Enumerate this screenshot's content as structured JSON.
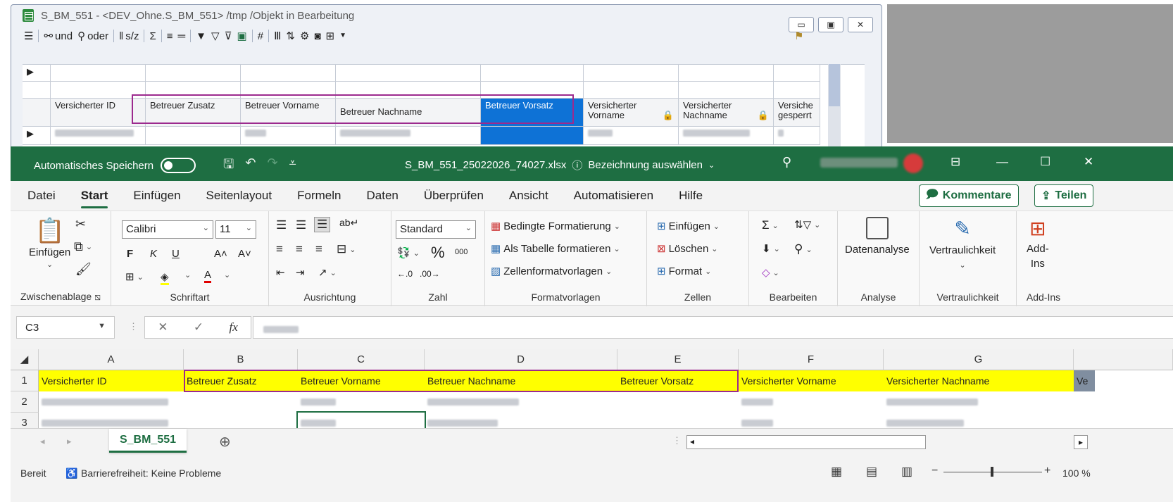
{
  "bg_window": {
    "title": "S_BM_551 - <DEV_Ohne.S_BM_551> /tmp /Objekt in Bearbeitung",
    "controls": {
      "minimize": "▭",
      "maximize": "▣",
      "close": "✕"
    },
    "toolbar": {
      "und_label": "und",
      "oder_label": "oder",
      "sz_label": "s/z",
      "hash_label": "#"
    },
    "grid": {
      "headers": [
        "Versicherter ID",
        "Betreuer Zusatz",
        "Betreuer Vorname",
        "Betreuer Nachname",
        "Betreuer Vorsatz",
        "Versicherter Vorname",
        "Versicherter Nachname",
        "Versiche gesperrt"
      ],
      "selected_col": 4
    }
  },
  "excel": {
    "title": {
      "autosave_label": "Automatisches Speichern",
      "filename": "S_BM_551_25022026_74027.xlsx",
      "label_hint": "Bezeichnung auswählen"
    },
    "menu": [
      "Datei",
      "Start",
      "Einfügen",
      "Seitenlayout",
      "Formeln",
      "Daten",
      "Überprüfen",
      "Ansicht",
      "Automatisieren",
      "Hilfe"
    ],
    "menu_active": 1,
    "comment_button": "Kommentare",
    "share_button": "Teilen",
    "ribbon": {
      "clipboard": {
        "paste": "Einfügen",
        "label": "Zwischenablage"
      },
      "font": {
        "name": "Calibri",
        "size": "11",
        "bold": "F",
        "italic": "K",
        "underline": "U",
        "grow": "A˄",
        "shrink": "A˅",
        "color_letter": "A",
        "label": "Schriftart"
      },
      "alignment": {
        "label": "Ausrichtung"
      },
      "number": {
        "format": "Standard",
        "percent": "%",
        "thousands": "000",
        "label": "Zahl"
      },
      "styles": {
        "conditional": "Bedingte Formatierung",
        "as_table": "Als Tabelle formatieren",
        "cell_styles": "Zellenformatvorlagen",
        "label": "Formatvorlagen"
      },
      "cells": {
        "insert": "Einfügen",
        "delete": "Löschen",
        "format": "Format",
        "label": "Zellen"
      },
      "editing": {
        "label": "Bearbeiten"
      },
      "analysis": {
        "button": "Datenanalyse",
        "label": "Analyse"
      },
      "sensitivity": {
        "button": "Vertraulichkeit",
        "label": "Vertraulichkeit"
      },
      "addins": {
        "button_line1": "Add-",
        "button_line2": "Ins",
        "label": "Add-Ins"
      }
    },
    "namebox": "C3",
    "fx": "fx",
    "columns": [
      "A",
      "B",
      "C",
      "D",
      "E",
      "F",
      "G"
    ],
    "rows": [
      "1",
      "2",
      "3"
    ],
    "header_row": [
      "Versicherter ID",
      "Betreuer Zusatz",
      "Betreuer Vorname",
      "Betreuer Nachname",
      "Betreuer Vorsatz",
      "Versicherter Vorname",
      "Versicherter Nachname",
      "Ve"
    ],
    "sheet_tab": "S_BM_551",
    "status": {
      "ready": "Bereit",
      "accessibility": "Barrierefreiheit: Keine Probleme",
      "zoom": "100 %"
    },
    "colors": {
      "excel_green": "#1e6e42",
      "highlight_purple": "#9c2a8e",
      "header_yellow": "#ffff00",
      "selection_blue": "#0e72d6"
    }
  }
}
